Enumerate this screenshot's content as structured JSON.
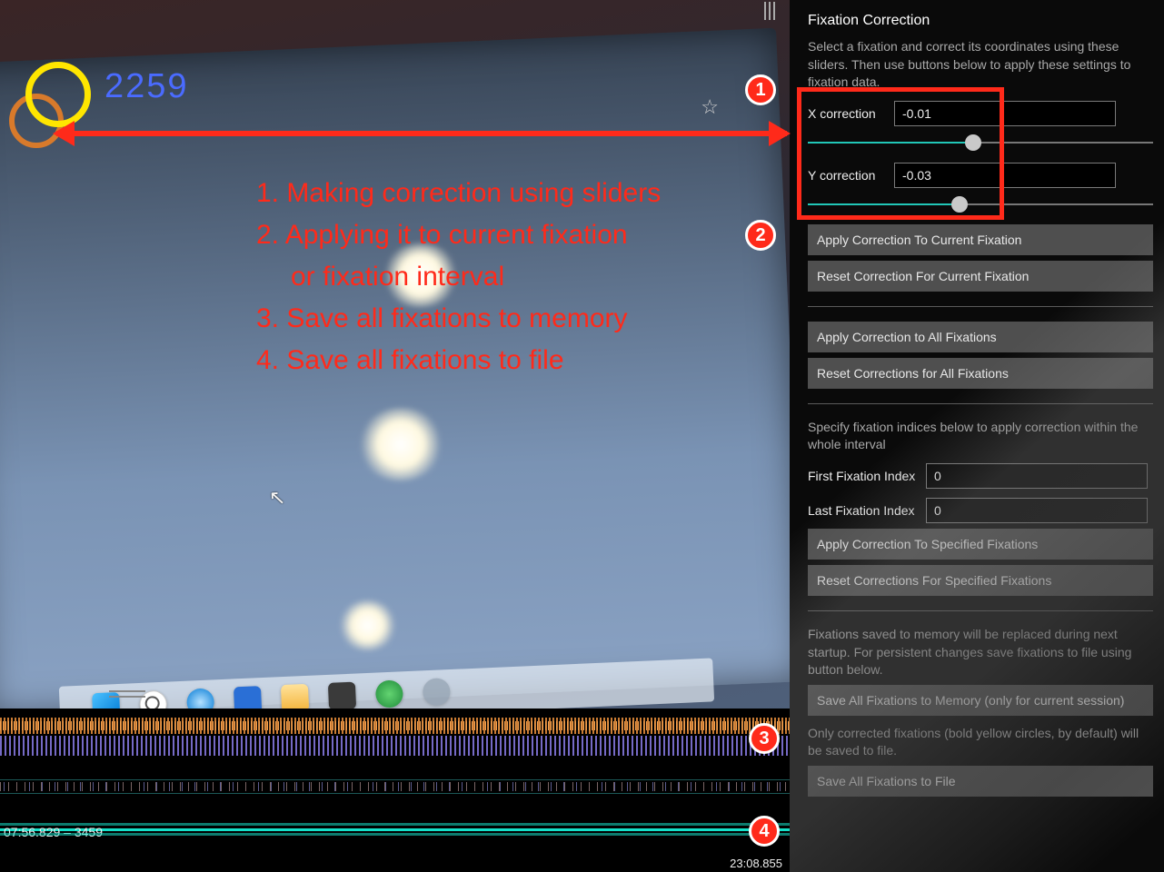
{
  "panel": {
    "title": "Fixation Correction",
    "intro": "Select a fixation and correct its coordinates using these sliders. Then use buttons below to apply these settings to fixation data.",
    "x_label": "X correction",
    "x_value": "-0.01",
    "x_slider_percent": 48,
    "y_label": "Y correction",
    "y_value": "-0.03",
    "y_slider_percent": 44,
    "btn_apply_current": "Apply Correction To Current Fixation",
    "btn_reset_current": "Reset Correction For Current Fixation",
    "btn_apply_all": "Apply Correction to All Fixations",
    "btn_reset_all": "Reset Corrections for All Fixations",
    "interval_help": "Specify fixation indices below to apply correction within the whole interval",
    "first_idx_label": "First Fixation Index",
    "first_idx_value": "0",
    "last_idx_label": "Last Fixation Index",
    "last_idx_value": "0",
    "btn_apply_specified": "Apply Correction To Specified Fixations",
    "btn_reset_specified": "Reset Corrections For Specified Fixations",
    "memory_help": "Fixations saved to memory will be replaced during next startup. For persistent changes save fixations to file using button below.",
    "btn_save_memory": "Save All Fixations to Memory (only for current session)",
    "file_help": "Only corrected fixations (bold yellow circles, by default) will be saved to file.",
    "btn_save_file": "Save All Fixations to File"
  },
  "viewport": {
    "fixation_number": "2259",
    "timestamp_left": "07:56.829 – 3459",
    "timestamp_right": "23:08.855"
  },
  "annotations": {
    "line1": "1. Making correction using sliders",
    "line2": "2. Applying it to current fixation",
    "line2b": "or fixation interval",
    "line3": "3. Save all fixations to memory",
    "line4": "4. Save all fixations to file",
    "badge1": "1",
    "badge2": "2",
    "badge3": "3",
    "badge4": "4"
  }
}
